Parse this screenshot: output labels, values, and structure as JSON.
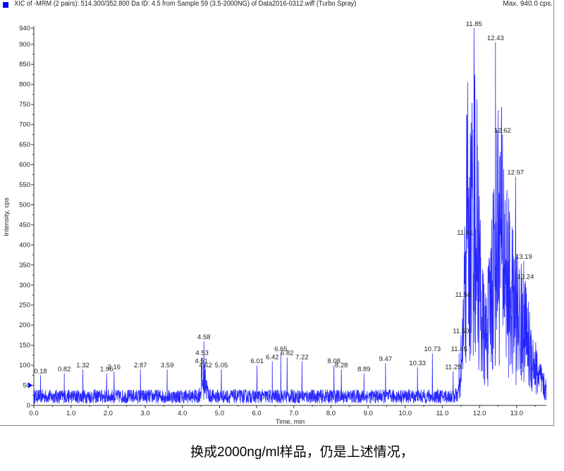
{
  "chart_data": {
    "type": "line",
    "title": "XIC of -MRM (2 pairs): 514.300/352.800 Da ID: 4.5 from Sample 59 (3.5-2000NG) of Data2016-0312.wiff (Turbo Spray)",
    "max_label": "Max. 940.0 cps.",
    "xlabel": "Time, min",
    "ylabel": "Intensity, cps",
    "xlim": [
      0,
      13.8
    ],
    "ylim": [
      0,
      940
    ],
    "xticks": [
      "0.0",
      "1.0",
      "2.0",
      "3.0",
      "4.0",
      "5.0",
      "6.0",
      "7.0",
      "8.0",
      "9.0",
      "10.0",
      "11.0",
      "12.0",
      "13.0"
    ],
    "yticks": [
      "0",
      "50",
      "100",
      "150",
      "200",
      "250",
      "300",
      "350",
      "400",
      "450",
      "500",
      "550",
      "600",
      "650",
      "700",
      "750",
      "800",
      "850",
      "900",
      "940"
    ],
    "series_color": "#0000ff",
    "peaks": [
      {
        "label": "0.18",
        "x": 0.18,
        "y": 75
      },
      {
        "label": "0.82",
        "x": 0.82,
        "y": 80
      },
      {
        "label": "1.32",
        "x": 1.32,
        "y": 90
      },
      {
        "label": "1.96",
        "x": 1.96,
        "y": 80
      },
      {
        "label": "2.16",
        "x": 2.16,
        "y": 85
      },
      {
        "label": "2.87",
        "x": 2.87,
        "y": 90
      },
      {
        "label": "3.59",
        "x": 3.59,
        "y": 90
      },
      {
        "label": "4.51",
        "x": 4.51,
        "y": 100
      },
      {
        "label": "4.53",
        "x": 4.53,
        "y": 120
      },
      {
        "label": "4.58",
        "x": 4.58,
        "y": 160
      },
      {
        "label": "4.62",
        "x": 4.62,
        "y": 90
      },
      {
        "label": "5.05",
        "x": 5.05,
        "y": 90
      },
      {
        "label": "6.01",
        "x": 6.01,
        "y": 100
      },
      {
        "label": "6.42",
        "x": 6.42,
        "y": 110
      },
      {
        "label": "6.65",
        "x": 6.65,
        "y": 130
      },
      {
        "label": "6.82",
        "x": 6.82,
        "y": 120
      },
      {
        "label": "7.22",
        "x": 7.22,
        "y": 110
      },
      {
        "label": "8.08",
        "x": 8.08,
        "y": 100
      },
      {
        "label": "8.28",
        "x": 8.28,
        "y": 90
      },
      {
        "label": "8.89",
        "x": 8.89,
        "y": 80
      },
      {
        "label": "9.47",
        "x": 9.47,
        "y": 105
      },
      {
        "label": "10.33",
        "x": 10.33,
        "y": 95
      },
      {
        "label": "10.73",
        "x": 10.73,
        "y": 130
      },
      {
        "label": "11.29",
        "x": 11.29,
        "y": 85
      },
      {
        "label": "11.45",
        "x": 11.45,
        "y": 130
      },
      {
        "label": "11.50",
        "x": 11.5,
        "y": 175
      },
      {
        "label": "11.56",
        "x": 11.56,
        "y": 265
      },
      {
        "label": "11.61",
        "x": 11.61,
        "y": 420
      },
      {
        "label": "11.85",
        "x": 11.85,
        "y": 940
      },
      {
        "label": "12.43",
        "x": 12.43,
        "y": 905
      },
      {
        "label": "12.62",
        "x": 12.62,
        "y": 675
      },
      {
        "label": "12.97",
        "x": 12.97,
        "y": 570
      },
      {
        "label": "13.19",
        "x": 13.19,
        "y": 360
      },
      {
        "label": "13.24",
        "x": 13.24,
        "y": 310
      }
    ]
  },
  "caption": "换成2000ng/ml样品，仍是上述情况，"
}
